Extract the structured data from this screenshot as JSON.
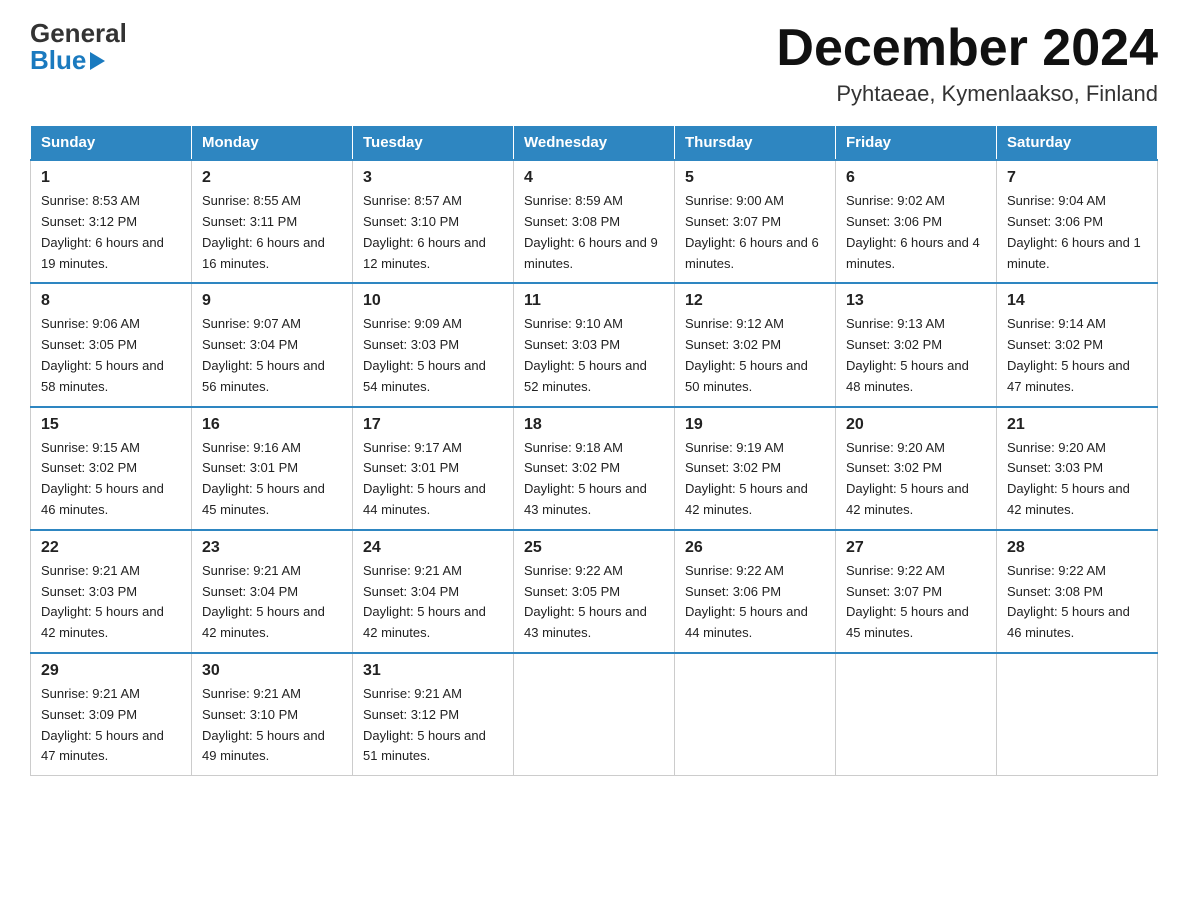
{
  "header": {
    "logo_general": "General",
    "logo_blue": "Blue",
    "month_title": "December 2024",
    "subtitle": "Pyhtaeae, Kymenlaakso, Finland"
  },
  "days_of_week": [
    "Sunday",
    "Monday",
    "Tuesday",
    "Wednesday",
    "Thursday",
    "Friday",
    "Saturday"
  ],
  "weeks": [
    [
      {
        "day": "1",
        "sunrise": "8:53 AM",
        "sunset": "3:12 PM",
        "daylight": "6 hours and 19 minutes."
      },
      {
        "day": "2",
        "sunrise": "8:55 AM",
        "sunset": "3:11 PM",
        "daylight": "6 hours and 16 minutes."
      },
      {
        "day": "3",
        "sunrise": "8:57 AM",
        "sunset": "3:10 PM",
        "daylight": "6 hours and 12 minutes."
      },
      {
        "day": "4",
        "sunrise": "8:59 AM",
        "sunset": "3:08 PM",
        "daylight": "6 hours and 9 minutes."
      },
      {
        "day": "5",
        "sunrise": "9:00 AM",
        "sunset": "3:07 PM",
        "daylight": "6 hours and 6 minutes."
      },
      {
        "day": "6",
        "sunrise": "9:02 AM",
        "sunset": "3:06 PM",
        "daylight": "6 hours and 4 minutes."
      },
      {
        "day": "7",
        "sunrise": "9:04 AM",
        "sunset": "3:06 PM",
        "daylight": "6 hours and 1 minute."
      }
    ],
    [
      {
        "day": "8",
        "sunrise": "9:06 AM",
        "sunset": "3:05 PM",
        "daylight": "5 hours and 58 minutes."
      },
      {
        "day": "9",
        "sunrise": "9:07 AM",
        "sunset": "3:04 PM",
        "daylight": "5 hours and 56 minutes."
      },
      {
        "day": "10",
        "sunrise": "9:09 AM",
        "sunset": "3:03 PM",
        "daylight": "5 hours and 54 minutes."
      },
      {
        "day": "11",
        "sunrise": "9:10 AM",
        "sunset": "3:03 PM",
        "daylight": "5 hours and 52 minutes."
      },
      {
        "day": "12",
        "sunrise": "9:12 AM",
        "sunset": "3:02 PM",
        "daylight": "5 hours and 50 minutes."
      },
      {
        "day": "13",
        "sunrise": "9:13 AM",
        "sunset": "3:02 PM",
        "daylight": "5 hours and 48 minutes."
      },
      {
        "day": "14",
        "sunrise": "9:14 AM",
        "sunset": "3:02 PM",
        "daylight": "5 hours and 47 minutes."
      }
    ],
    [
      {
        "day": "15",
        "sunrise": "9:15 AM",
        "sunset": "3:02 PM",
        "daylight": "5 hours and 46 minutes."
      },
      {
        "day": "16",
        "sunrise": "9:16 AM",
        "sunset": "3:01 PM",
        "daylight": "5 hours and 45 minutes."
      },
      {
        "day": "17",
        "sunrise": "9:17 AM",
        "sunset": "3:01 PM",
        "daylight": "5 hours and 44 minutes."
      },
      {
        "day": "18",
        "sunrise": "9:18 AM",
        "sunset": "3:02 PM",
        "daylight": "5 hours and 43 minutes."
      },
      {
        "day": "19",
        "sunrise": "9:19 AM",
        "sunset": "3:02 PM",
        "daylight": "5 hours and 42 minutes."
      },
      {
        "day": "20",
        "sunrise": "9:20 AM",
        "sunset": "3:02 PM",
        "daylight": "5 hours and 42 minutes."
      },
      {
        "day": "21",
        "sunrise": "9:20 AM",
        "sunset": "3:03 PM",
        "daylight": "5 hours and 42 minutes."
      }
    ],
    [
      {
        "day": "22",
        "sunrise": "9:21 AM",
        "sunset": "3:03 PM",
        "daylight": "5 hours and 42 minutes."
      },
      {
        "day": "23",
        "sunrise": "9:21 AM",
        "sunset": "3:04 PM",
        "daylight": "5 hours and 42 minutes."
      },
      {
        "day": "24",
        "sunrise": "9:21 AM",
        "sunset": "3:04 PM",
        "daylight": "5 hours and 42 minutes."
      },
      {
        "day": "25",
        "sunrise": "9:22 AM",
        "sunset": "3:05 PM",
        "daylight": "5 hours and 43 minutes."
      },
      {
        "day": "26",
        "sunrise": "9:22 AM",
        "sunset": "3:06 PM",
        "daylight": "5 hours and 44 minutes."
      },
      {
        "day": "27",
        "sunrise": "9:22 AM",
        "sunset": "3:07 PM",
        "daylight": "5 hours and 45 minutes."
      },
      {
        "day": "28",
        "sunrise": "9:22 AM",
        "sunset": "3:08 PM",
        "daylight": "5 hours and 46 minutes."
      }
    ],
    [
      {
        "day": "29",
        "sunrise": "9:21 AM",
        "sunset": "3:09 PM",
        "daylight": "5 hours and 47 minutes."
      },
      {
        "day": "30",
        "sunrise": "9:21 AM",
        "sunset": "3:10 PM",
        "daylight": "5 hours and 49 minutes."
      },
      {
        "day": "31",
        "sunrise": "9:21 AM",
        "sunset": "3:12 PM",
        "daylight": "5 hours and 51 minutes."
      },
      null,
      null,
      null,
      null
    ]
  ],
  "labels": {
    "sunrise": "Sunrise:",
    "sunset": "Sunset:",
    "daylight": "Daylight:"
  }
}
